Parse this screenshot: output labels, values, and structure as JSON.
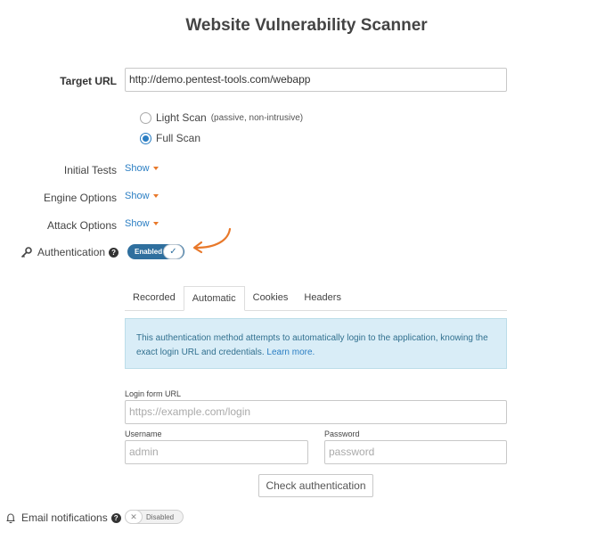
{
  "page": {
    "title": "Website Vulnerability Scanner"
  },
  "target": {
    "label": "Target URL",
    "value": "http://demo.pentest-tools.com/webapp"
  },
  "scan_type": {
    "light_label": "Light Scan",
    "light_note": "(passive, non-intrusive)",
    "full_label": "Full Scan",
    "selected": "Full Scan"
  },
  "options": {
    "initial_tests": {
      "label": "Initial Tests",
      "link": "Show"
    },
    "engine_options": {
      "label": "Engine Options",
      "link": "Show"
    },
    "attack_options": {
      "label": "Attack Options",
      "link": "Show"
    }
  },
  "authentication": {
    "label": "Authentication",
    "help": "?",
    "toggle_label": "Enabled",
    "toggle_state": "on",
    "check": "✓"
  },
  "auth_tabs": [
    {
      "label": "Recorded",
      "active": false
    },
    {
      "label": "Automatic",
      "active": true
    },
    {
      "label": "Cookies",
      "active": false
    },
    {
      "label": "Headers",
      "active": false
    }
  ],
  "info": {
    "text": "This authentication method attempts to automatically login to the application, knowing the exact login URL and credentials.",
    "link": "Learn more."
  },
  "login_form": {
    "url_label": "Login form URL",
    "url_placeholder": "https://example.com/login",
    "username_label": "Username",
    "username_placeholder": "admin",
    "password_label": "Password",
    "password_placeholder": "password",
    "check_button": "Check authentication"
  },
  "email": {
    "label": "Email notifications",
    "help": "?",
    "toggle_label": "Disabled",
    "toggle_state": "off",
    "x": "✕"
  },
  "colors": {
    "accent": "#2b7ec3",
    "toggle_on": "#2f6f9e",
    "arrow": "#e8782a",
    "info_bg": "#d9edf7"
  }
}
